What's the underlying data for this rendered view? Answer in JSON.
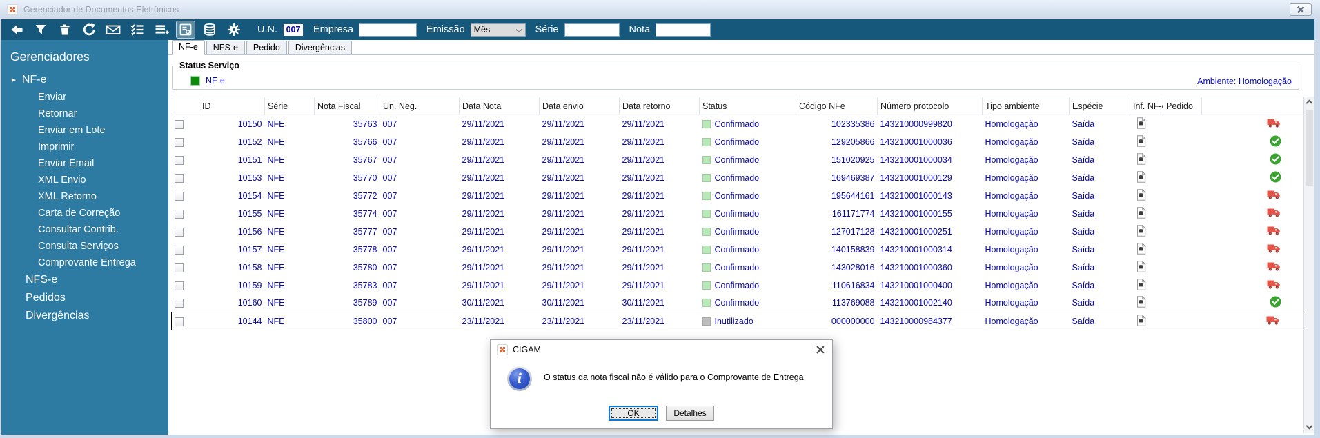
{
  "window": {
    "title": "Gerenciador de Documentos Eletrônicos"
  },
  "toolbar": {
    "icons": [
      {
        "name": "back-icon"
      },
      {
        "name": "filter-icon"
      },
      {
        "name": "delete-icon"
      },
      {
        "name": "refresh-icon"
      },
      {
        "name": "email-icon"
      },
      {
        "name": "checklist-icon"
      },
      {
        "name": "add-list-icon"
      },
      {
        "name": "delivery-receipt-icon",
        "active": true
      },
      {
        "name": "database-icon"
      },
      {
        "name": "settings-icon"
      }
    ],
    "un": {
      "label": "U.N.",
      "value": "007"
    },
    "empresa": {
      "label": "Empresa",
      "value": ""
    },
    "emissao": {
      "label": "Emissão",
      "value": "Mês"
    },
    "serie": {
      "label": "Série",
      "value": ""
    },
    "nota": {
      "label": "Nota",
      "value": ""
    }
  },
  "sidebar": {
    "header": "Gerenciadores",
    "root": {
      "label": "NF-e",
      "arrow": "►"
    },
    "children": [
      "Enviar",
      "Retornar",
      "Enviar em Lote",
      "Imprimir",
      "Enviar Email",
      "XML Envio",
      "XML Retorno",
      "Carta de Correção",
      "Consultar Contrib.",
      "Consulta Serviços",
      "Comprovante Entrega"
    ],
    "others": [
      "NFS-e",
      "Pedidos",
      "Divergências"
    ]
  },
  "tabs": {
    "items": [
      "NF-e",
      "NFS-e",
      "Pedido",
      "Divergências"
    ],
    "active_index": 0
  },
  "status_servico": {
    "title": "Status Serviço",
    "legend_label": "NF-e",
    "legend_color": "#0c8a0c",
    "ambiente": "Ambiente: Homologação"
  },
  "table": {
    "headers": [
      "",
      "ID",
      "Série",
      "Nota Fiscal",
      "Un. Neg.",
      "Data Nota",
      "Data envio",
      "Data retorno",
      "Status",
      "Código NFe",
      "Número protocolo",
      "Tipo ambiente",
      "Espécie",
      "Inf. NF-e",
      "Pedido",
      ""
    ],
    "status_colors": {
      "Confirmado": "#b9e8b9",
      "Inutilizado": "#bdbdbd"
    },
    "rows": [
      {
        "id": "10150",
        "serie": "NFE",
        "nota_fiscal": "35763",
        "un_neg": "007",
        "data_nota": "29/11/2021",
        "data_envio": "29/11/2021",
        "data_retorno": "29/11/2021",
        "status": "Confirmado",
        "codigo_nfe": "102335386",
        "numero_protocolo": "143210000999820",
        "tipo_ambiente": "Homologação",
        "especie": "Saída",
        "entrega": "truck",
        "selected": false
      },
      {
        "id": "10152",
        "serie": "NFE",
        "nota_fiscal": "35766",
        "un_neg": "007",
        "data_nota": "29/11/2021",
        "data_envio": "29/11/2021",
        "data_retorno": "29/11/2021",
        "status": "Confirmado",
        "codigo_nfe": "129205866",
        "numero_protocolo": "143210001000036",
        "tipo_ambiente": "Homologação",
        "especie": "Saída",
        "entrega": "check",
        "selected": false
      },
      {
        "id": "10151",
        "serie": "NFE",
        "nota_fiscal": "35767",
        "un_neg": "007",
        "data_nota": "29/11/2021",
        "data_envio": "29/11/2021",
        "data_retorno": "29/11/2021",
        "status": "Confirmado",
        "codigo_nfe": "151020925",
        "numero_protocolo": "143210001000034",
        "tipo_ambiente": "Homologação",
        "especie": "Saída",
        "entrega": "check",
        "selected": false
      },
      {
        "id": "10153",
        "serie": "NFE",
        "nota_fiscal": "35770",
        "un_neg": "007",
        "data_nota": "29/11/2021",
        "data_envio": "29/11/2021",
        "data_retorno": "29/11/2021",
        "status": "Confirmado",
        "codigo_nfe": "169469387",
        "numero_protocolo": "143210001000129",
        "tipo_ambiente": "Homologação",
        "especie": "Saída",
        "entrega": "check",
        "selected": false
      },
      {
        "id": "10154",
        "serie": "NFE",
        "nota_fiscal": "35772",
        "un_neg": "007",
        "data_nota": "29/11/2021",
        "data_envio": "29/11/2021",
        "data_retorno": "29/11/2021",
        "status": "Confirmado",
        "codigo_nfe": "195644161",
        "numero_protocolo": "143210001000143",
        "tipo_ambiente": "Homologação",
        "especie": "Saída",
        "entrega": "truck",
        "selected": false
      },
      {
        "id": "10155",
        "serie": "NFE",
        "nota_fiscal": "35774",
        "un_neg": "007",
        "data_nota": "29/11/2021",
        "data_envio": "29/11/2021",
        "data_retorno": "29/11/2021",
        "status": "Confirmado",
        "codigo_nfe": "161171774",
        "numero_protocolo": "143210001000155",
        "tipo_ambiente": "Homologação",
        "especie": "Saída",
        "entrega": "truck",
        "selected": false
      },
      {
        "id": "10156",
        "serie": "NFE",
        "nota_fiscal": "35777",
        "un_neg": "007",
        "data_nota": "29/11/2021",
        "data_envio": "29/11/2021",
        "data_retorno": "29/11/2021",
        "status": "Confirmado",
        "codigo_nfe": "127017128",
        "numero_protocolo": "143210001000251",
        "tipo_ambiente": "Homologação",
        "especie": "Saída",
        "entrega": "truck",
        "selected": false
      },
      {
        "id": "10157",
        "serie": "NFE",
        "nota_fiscal": "35778",
        "un_neg": "007",
        "data_nota": "29/11/2021",
        "data_envio": "29/11/2021",
        "data_retorno": "29/11/2021",
        "status": "Confirmado",
        "codigo_nfe": "140158839",
        "numero_protocolo": "143210001000314",
        "tipo_ambiente": "Homologação",
        "especie": "Saída",
        "entrega": "truck",
        "selected": false
      },
      {
        "id": "10158",
        "serie": "NFE",
        "nota_fiscal": "35780",
        "un_neg": "007",
        "data_nota": "29/11/2021",
        "data_envio": "29/11/2021",
        "data_retorno": "29/11/2021",
        "status": "Confirmado",
        "codigo_nfe": "143028016",
        "numero_protocolo": "143210001000360",
        "tipo_ambiente": "Homologação",
        "especie": "Saída",
        "entrega": "truck",
        "selected": false
      },
      {
        "id": "10159",
        "serie": "NFE",
        "nota_fiscal": "35783",
        "un_neg": "007",
        "data_nota": "29/11/2021",
        "data_envio": "29/11/2021",
        "data_retorno": "29/11/2021",
        "status": "Confirmado",
        "codigo_nfe": "110616834",
        "numero_protocolo": "143210001000400",
        "tipo_ambiente": "Homologação",
        "especie": "Saída",
        "entrega": "truck",
        "selected": false
      },
      {
        "id": "10160",
        "serie": "NFE",
        "nota_fiscal": "35789",
        "un_neg": "007",
        "data_nota": "30/11/2021",
        "data_envio": "30/11/2021",
        "data_retorno": "30/11/2021",
        "status": "Confirmado",
        "codigo_nfe": "113769088",
        "numero_protocolo": "143210001002140",
        "tipo_ambiente": "Homologação",
        "especie": "Saída",
        "entrega": "check",
        "selected": false
      },
      {
        "id": "10144",
        "serie": "NFE",
        "nota_fiscal": "35800",
        "un_neg": "007",
        "data_nota": "23/11/2021",
        "data_envio": "23/11/2021",
        "data_retorno": "23/11/2021",
        "status": "Inutilizado",
        "codigo_nfe": "000000000",
        "numero_protocolo": "143210000984377",
        "tipo_ambiente": "Homologação",
        "especie": "Saída",
        "entrega": "truck",
        "selected": true
      }
    ]
  },
  "dialog": {
    "title": "CIGAM",
    "info_glyph": "i",
    "message": "O status da nota fiscal não é válido para o Comprovante de Entrega",
    "ok_label": "OK",
    "details_label": "Detalhes"
  },
  "colors": {
    "toolbar": "#15587c",
    "sidebar": "#2d7ba3",
    "value_text": "#0909b0",
    "ambiente_text": "#0b0bcc"
  }
}
